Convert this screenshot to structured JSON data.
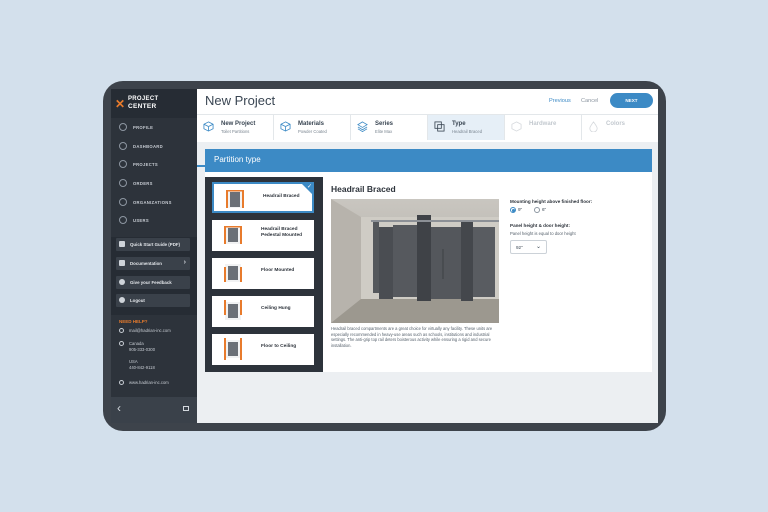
{
  "app": {
    "logo_line1": "PROJECT",
    "logo_line2": "CENTER"
  },
  "sidebar": {
    "nav": [
      {
        "label": "Profile",
        "icon": "user-icon"
      },
      {
        "label": "Dashboard",
        "icon": "dashboard-icon"
      },
      {
        "label": "Projects",
        "icon": "folder-icon"
      },
      {
        "label": "Orders",
        "icon": "box-icon"
      },
      {
        "label": "Organizations",
        "icon": "building-icon"
      },
      {
        "label": "Users",
        "icon": "users-icon"
      }
    ],
    "actions": [
      {
        "label": "Quick Start Guide (PDF)",
        "icon": "book-icon"
      },
      {
        "label": "Documentation",
        "icon": "folder-icon"
      },
      {
        "label": "Give your Feedback",
        "icon": "chat-icon"
      },
      {
        "label": "Logout",
        "icon": "logout-icon"
      }
    ],
    "help": {
      "title": "NEED HELP?",
      "email": "mail@hadrian-inc.com",
      "canada_label": "Canada",
      "canada_phone": "905-333-0300",
      "usa_label": "USA",
      "usa_phone": "440-842-9118",
      "website": "www.hadrian-inc.com"
    }
  },
  "header": {
    "title": "New Project",
    "previous_label": "Previous",
    "cancel_label": "Cancel",
    "next_label": "NEXT"
  },
  "steps": [
    {
      "name": "New Project",
      "sub": "Toilet Partitions",
      "state": "done"
    },
    {
      "name": "Materials",
      "sub": "Powder Coated",
      "state": "done"
    },
    {
      "name": "Series",
      "sub": "Elite Max",
      "state": "done"
    },
    {
      "name": "Type",
      "sub": "Headrail Braced",
      "state": "active"
    },
    {
      "name": "Hardware",
      "sub": "",
      "state": "disabled"
    },
    {
      "name": "Colors",
      "sub": "",
      "state": "disabled"
    }
  ],
  "panel": {
    "title": "Partition type",
    "types": [
      {
        "label": "Headrail Braced",
        "selected": true
      },
      {
        "label": "Headrail Braced Pedestal Mounted",
        "selected": false
      },
      {
        "label": "Floor Mounted",
        "selected": false
      },
      {
        "label": "Ceiling Hung",
        "selected": false
      },
      {
        "label": "Floor to Ceiling",
        "selected": false
      }
    ],
    "detail_title": "Headrail Braced",
    "description": "Headrail braced compartments are a great choice for virtually any facility. These units are especially recommended in heavy-use areas such as schools, institutions and industrial settings. The anti-grip top rail deters boisterous activity while ensuring a rigid and secure installation.",
    "mounting_label": "Mounting height above finished floor:",
    "mounting_options": [
      {
        "label": "9\"",
        "selected": true
      },
      {
        "label": "6\"",
        "selected": false
      }
    ],
    "panel_height_label": "Panel height & door height:",
    "panel_height_sub": "Panel height is equal to door height",
    "panel_height_value": "92\""
  },
  "colors": {
    "accent": "#3c8ac5",
    "sidebar_bg": "#262c34",
    "help_title": "#e87b2c"
  }
}
